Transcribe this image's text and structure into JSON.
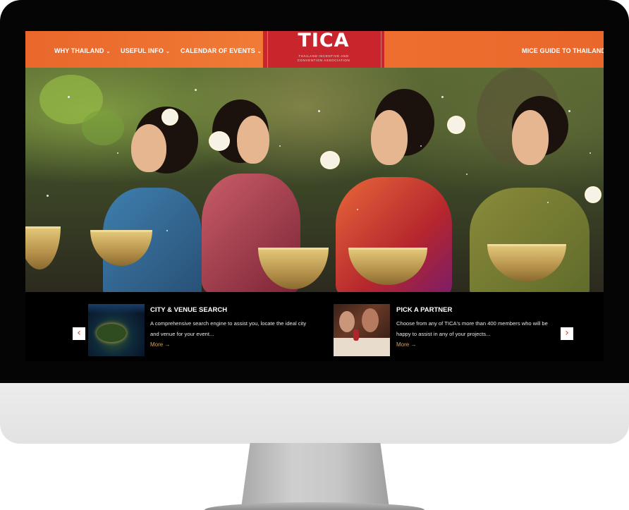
{
  "nav": {
    "items": [
      {
        "label": "WHY THAILAND",
        "caret": "⌄"
      },
      {
        "label": "USEFUL INFO",
        "caret": "⌄"
      },
      {
        "label": "CALENDAR OF EVENTS",
        "caret": "⌄"
      }
    ],
    "right_item": "MICE GUIDE TO THAILAND",
    "logo": {
      "text": "TICA",
      "subtitle_line1": "THAILAND INCENTIVE AND",
      "subtitle_line2": "CONVENTION ASSOCIATION"
    }
  },
  "hero": {
    "icon": "photo-songkran-women"
  },
  "cards": [
    {
      "title": "CITY & VENUE SEARCH",
      "description": "A comprehensive search engine to assist you, locate the ideal city and venue for your event...",
      "more": "More →",
      "thumb_icon": "satellite-map-thumbnail"
    },
    {
      "title": "PICK A PARTNER",
      "description": "Choose from any of TICA's more than 400 members who will be happy to assist in any of your projects...",
      "more": "More →",
      "thumb_icon": "dinner-party-thumbnail"
    }
  ],
  "carousel": {
    "prev_icon": "‹",
    "next_icon": "›"
  },
  "colors": {
    "nav_orange": "#ee6f30",
    "logo_red": "#c8262c",
    "more_gold": "#d7a05a"
  }
}
